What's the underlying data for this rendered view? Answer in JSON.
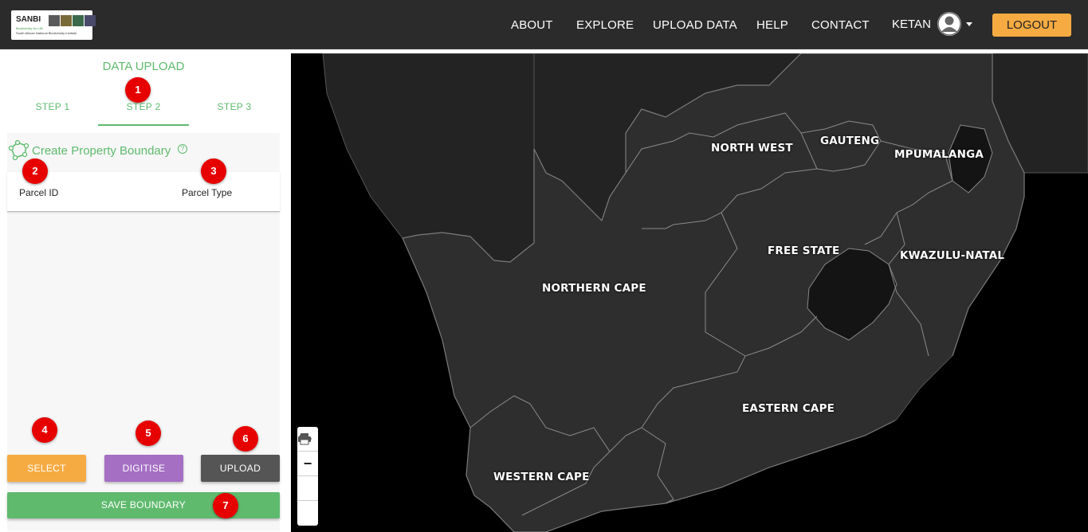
{
  "logo": {
    "brand": "SANBI",
    "tagline_top": "Biodiversity for Life",
    "tagline_bottom": "South African National Biodiversity Institute"
  },
  "nav": {
    "about": "ABOUT",
    "explore": "EXPLORE",
    "upload": "UPLOAD DATA",
    "help": "HELP",
    "contact": "CONTACT"
  },
  "user": {
    "name": "KETAN",
    "logout": "LOGOUT"
  },
  "panel": {
    "title": "DATA UPLOAD",
    "tabs": [
      {
        "label": "STEP 1"
      },
      {
        "label": "STEP 2"
      },
      {
        "label": "STEP 3"
      }
    ],
    "active_tab": "STEP 2",
    "section_title": "Create Property Boundary",
    "columns": [
      {
        "label": "Parcel ID"
      },
      {
        "label": "Parcel Type"
      }
    ],
    "buttons": {
      "select": "SELECT",
      "digitise": "DIGITISE",
      "upload": "UPLOAD",
      "save": "SAVE BOUNDARY"
    }
  },
  "badges": [
    "1",
    "2",
    "3",
    "4",
    "5",
    "6",
    "7"
  ],
  "map": {
    "provinces": [
      {
        "name": "NORTH WEST"
      },
      {
        "name": "GAUTENG"
      },
      {
        "name": "MPUMALANGA"
      },
      {
        "name": "FREE STATE"
      },
      {
        "name": "KWAZULU-NATAL"
      },
      {
        "name": "NORTHERN CAPE"
      },
      {
        "name": "EASTERN CAPE"
      },
      {
        "name": "WESTERN CAPE"
      }
    ],
    "controls": {
      "zoom_in": "+",
      "zoom_out": "−"
    }
  },
  "colors": {
    "accent_green": "#5fba6e",
    "logout": "#f6ab42",
    "select": "#f6ab42",
    "digitise": "#a56fc4",
    "upload": "#555555",
    "save": "#5fba6e",
    "badge": "#e60000"
  }
}
